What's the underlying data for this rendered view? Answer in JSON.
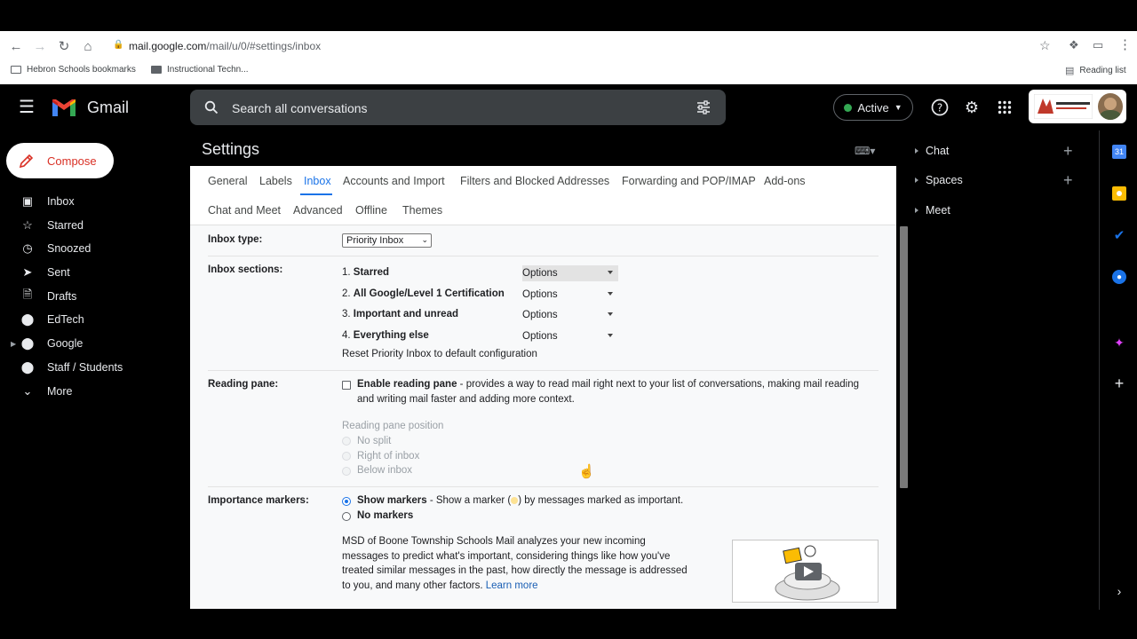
{
  "browser": {
    "url_host": "mail.google.com",
    "url_path": "/mail/u/0/#settings/inbox",
    "bookmarks": [
      {
        "label": "Hebron Schools bookmarks"
      },
      {
        "label": "Instructional Techn..."
      }
    ],
    "reading_list_label": "Reading list"
  },
  "gmail": {
    "logo_text": "Gmail",
    "search_placeholder": "Search all conversations",
    "status_label": "Active"
  },
  "nav": {
    "compose_label": "Compose",
    "items": [
      {
        "label": "Inbox"
      },
      {
        "label": "Starred"
      },
      {
        "label": "Snoozed"
      },
      {
        "label": "Sent"
      },
      {
        "label": "Drafts"
      },
      {
        "label": "EdTech"
      },
      {
        "label": "Google"
      },
      {
        "label": "Staff / Students"
      },
      {
        "label": "More"
      }
    ]
  },
  "settings": {
    "title": "Settings",
    "tabs": [
      {
        "label": "General"
      },
      {
        "label": "Labels"
      },
      {
        "label": "Inbox"
      },
      {
        "label": "Accounts and Import"
      },
      {
        "label": "Filters and Blocked Addresses"
      },
      {
        "label": "Forwarding and POP/IMAP"
      },
      {
        "label": "Add-ons"
      },
      {
        "label": "Chat and Meet"
      },
      {
        "label": "Advanced"
      },
      {
        "label": "Offline"
      },
      {
        "label": "Themes"
      }
    ],
    "inbox_type": {
      "label": "Inbox type:",
      "value": "Priority Inbox"
    },
    "inbox_sections": {
      "label": "Inbox sections:",
      "sections": [
        {
          "num": "1.",
          "name": "Starred",
          "options": "Options"
        },
        {
          "num": "2.",
          "name": "All Google/Level 1 Certification",
          "options": "Options"
        },
        {
          "num": "3.",
          "name": "Important and unread",
          "options": "Options"
        },
        {
          "num": "4.",
          "name": "Everything else",
          "options": "Options"
        }
      ],
      "reset_link": "Reset Priority Inbox to default configuration"
    },
    "reading_pane": {
      "label": "Reading pane:",
      "enable_bold": "Enable reading pane",
      "enable_desc_line1": " - provides a way to read mail right next to your list of conversations, making mail reading",
      "enable_desc_line2": "and writing mail faster and adding more context.",
      "position_label": "Reading pane position",
      "positions": [
        "No split",
        "Right of inbox",
        "Below inbox"
      ]
    },
    "importance_markers": {
      "label": "Importance markers:",
      "show_bold": "Show markers",
      "show_desc_pre": " - Show a marker (",
      "show_desc_post": ") by messages marked as important.",
      "no_markers": "No markers",
      "info_line1": "MSD of Boone Township Schools Mail analyzes your new incoming",
      "info_line2": "messages to predict what's important, considering things like how you've",
      "info_line3": "treated similar messages in the past, how directly the message is addressed",
      "info_line4": "to you, and many other factors.",
      "learn_more": "Learn more"
    }
  },
  "side_panel": {
    "items": [
      {
        "label": "Chat"
      },
      {
        "label": "Spaces"
      },
      {
        "label": "Meet"
      }
    ]
  },
  "colors": {
    "accent": "#1a73e8",
    "compose_text": "#d93025",
    "status_green": "#34a853"
  }
}
